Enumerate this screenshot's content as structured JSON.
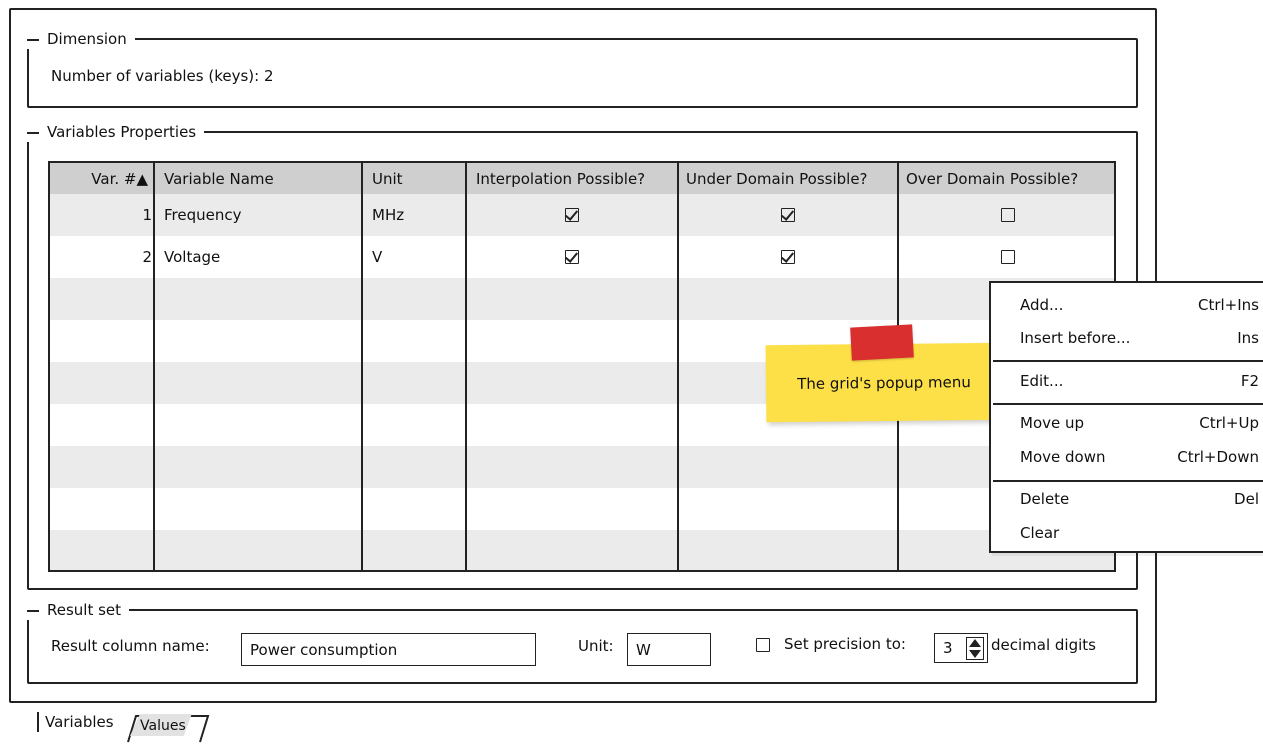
{
  "dimension": {
    "title": "Dimension",
    "variables_text": "Number of variables (keys): 2"
  },
  "variables": {
    "title": "Variables Properties",
    "columns": [
      "Var. #▲",
      "Variable Name",
      "Unit",
      "Interpolation Possible?",
      "Under Domain Possible?",
      "Over Domain Possible?"
    ],
    "rows": [
      {
        "num": "1",
        "name": "Frequency",
        "unit": "MHz",
        "interpolation": true,
        "under_domain": true,
        "over_domain": false
      },
      {
        "num": "2",
        "name": "Voltage",
        "unit": "V",
        "interpolation": true,
        "under_domain": true,
        "over_domain": false
      }
    ]
  },
  "result_set": {
    "title": "Result set",
    "column_name_label": "Result column name:",
    "column_name_value": "Power consumption",
    "unit_label": "Unit:",
    "unit_value": "W",
    "precision_checked": false,
    "precision_label": "Set precision to:",
    "precision_value": "3",
    "precision_suffix": "decimal digits"
  },
  "tabs": [
    {
      "label": "Variables",
      "active": true
    },
    {
      "label": "Values",
      "active": false
    }
  ],
  "popup_menu": {
    "items": [
      {
        "label": "Add...",
        "shortcut": "Ctrl+Ins"
      },
      {
        "label": "Insert before...",
        "shortcut": "Ins"
      },
      {
        "label": "Edit...",
        "shortcut": "F2"
      },
      {
        "label": "Move up",
        "shortcut": "Ctrl+Up"
      },
      {
        "label": "Move down",
        "shortcut": "Ctrl+Down"
      },
      {
        "label": "Delete",
        "shortcut": "Del"
      },
      {
        "label": "Clear",
        "shortcut": ""
      }
    ]
  },
  "sticky_note": {
    "text": "The grid's popup menu",
    "color": "#fde047",
    "tape_color": "#d92f2f"
  }
}
